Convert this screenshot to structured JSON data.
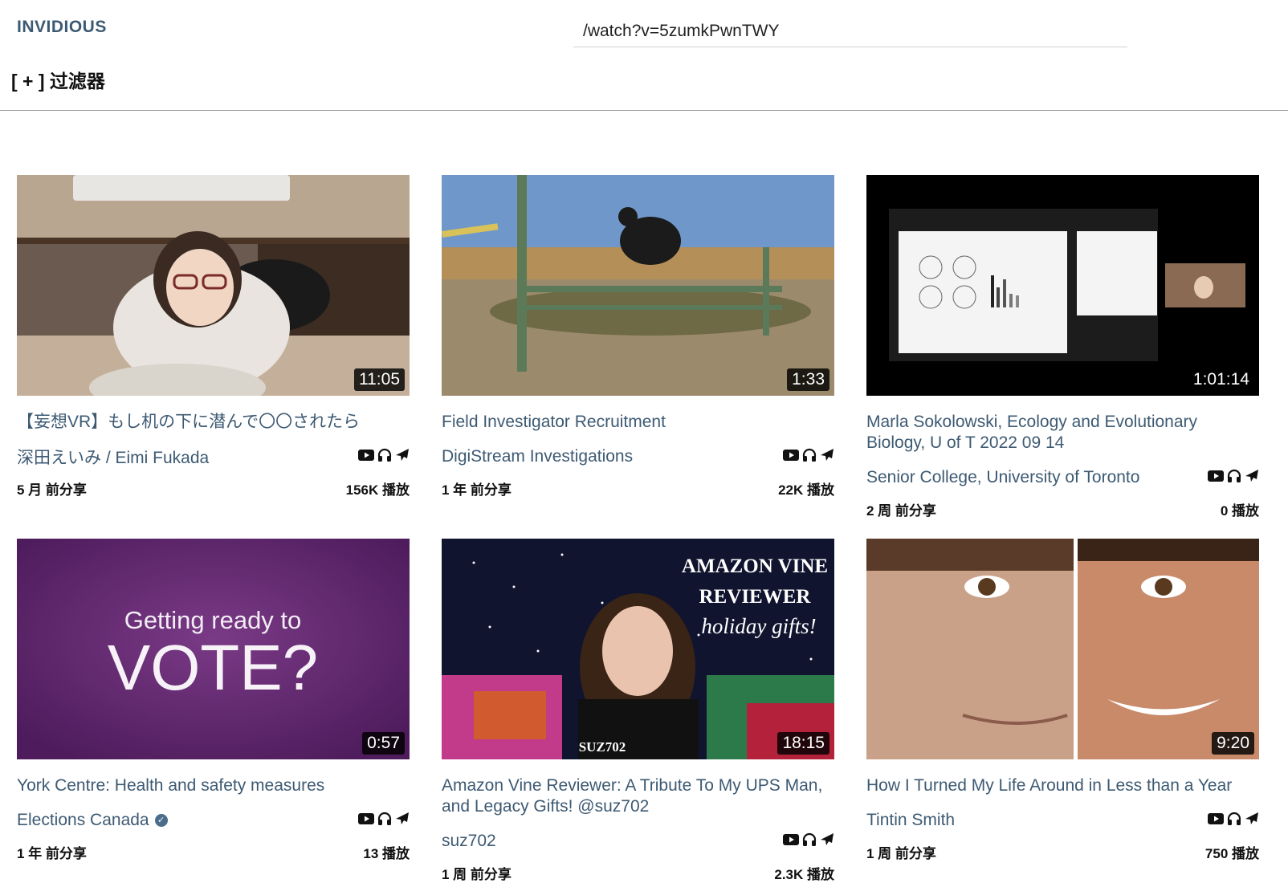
{
  "header": {
    "logo": "INVIDIOUS",
    "search_value": "/watch?v=5zumkPwnTWY"
  },
  "filters": {
    "toggle_label": "[ + ]  过滤器"
  },
  "videos": [
    {
      "title": "【妄想VR】もし机の下に潜んで〇〇されたら",
      "channel": "深田えいみ / Eimi Fukada",
      "duration": "11:05",
      "published": "5 月 前分享",
      "views": "156K 播放",
      "verified": false
    },
    {
      "title": "Field Investigator Recruitment",
      "channel": "DigiStream Investigations",
      "duration": "1:33",
      "published": "1 年 前分享",
      "views": "22K 播放",
      "verified": false
    },
    {
      "title": "Marla Sokolowski, Ecology and Evolutionary Biology, U of T 2022 09 14",
      "channel": "Senior College, University of Toronto",
      "duration": "1:01:14",
      "published": "2 周 前分享",
      "views": "0 播放",
      "verified": false
    },
    {
      "title": "York Centre: Health and safety measures",
      "channel": "Elections Canada",
      "duration": "0:57",
      "published": "1 年 前分享",
      "views": "13 播放",
      "verified": true
    },
    {
      "title": "Amazon Vine Reviewer: A Tribute To My UPS Man, and Legacy Gifts! @suz702",
      "channel": "suz702",
      "duration": "18:15",
      "published": "1 周 前分享",
      "views": "2.3K 播放",
      "verified": false
    },
    {
      "title": "How I Turned My Life Around in Less than a Year",
      "channel": "Tintin Smith",
      "duration": "9:20",
      "published": "1 周 前分享",
      "views": "750 播放",
      "verified": false
    }
  ],
  "thumbnail_text": {
    "vote_line1": "Getting ready to",
    "vote_line2": "VOTE?",
    "amazon_line1": "AMAZON VINE",
    "amazon_line2": "REVIEWER",
    "amazon_line3": "holiday gifts!",
    "amazon_brand": "SUZ702"
  },
  "icons": {
    "watch": "youtube-icon",
    "listen": "headphones-icon",
    "redirect": "airplane-icon"
  },
  "colors": {
    "link": "#3d5a73",
    "rule": "#999999",
    "duration_bg": "#000000"
  }
}
